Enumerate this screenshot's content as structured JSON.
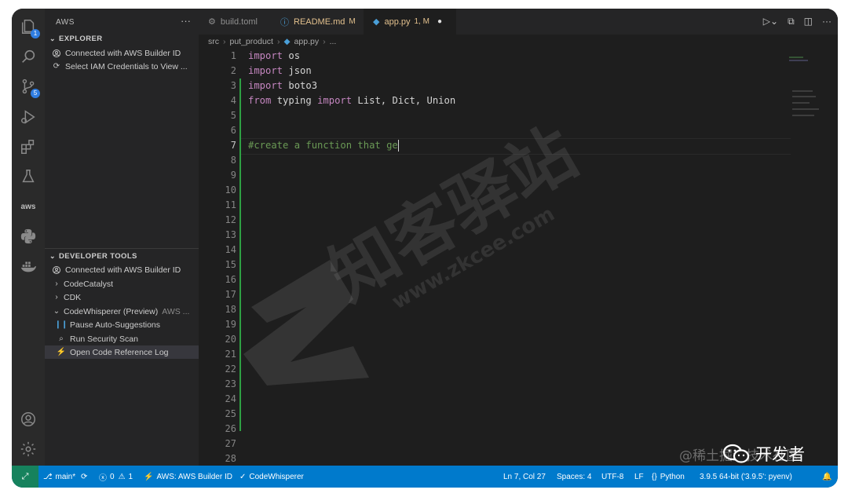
{
  "sidebar": {
    "title": "AWS",
    "more": "···",
    "explorer": {
      "header": "EXPLORER",
      "items": [
        {
          "label": "Connected with AWS Builder ID"
        },
        {
          "label": "Select IAM Credentials to View ..."
        }
      ]
    },
    "devtools": {
      "header": "DEVELOPER TOOLS",
      "items": [
        {
          "label": "Connected with AWS Builder ID"
        },
        {
          "label": "CodeCatalyst"
        },
        {
          "label": "CDK"
        },
        {
          "label": "CodeWhisperer (Preview)",
          "sub": "AWS ..."
        },
        {
          "label": "Pause Auto-Suggestions"
        },
        {
          "label": "Run Security Scan"
        },
        {
          "label": "Open Code Reference Log"
        }
      ]
    }
  },
  "activity": {
    "explorer_badge": "1",
    "scm_badge": "5",
    "aws_label": "aws"
  },
  "tabs": [
    {
      "label": "build.toml",
      "status": ""
    },
    {
      "label": "README.md",
      "status": "M"
    },
    {
      "label": "app.py",
      "status": "1, M"
    }
  ],
  "breadcrumb": [
    "src",
    "put_product",
    "app.py",
    "..."
  ],
  "editor": {
    "line_numbers": [
      "1",
      "2",
      "3",
      "4",
      "5",
      "6",
      "7",
      "8",
      "9",
      "10",
      "11",
      "12",
      "13",
      "14",
      "15",
      "16",
      "17",
      "18",
      "19",
      "20",
      "21",
      "22",
      "23",
      "24",
      "25",
      "26",
      "27",
      "28"
    ],
    "lines": [
      {
        "kw": "import",
        "rest": " os"
      },
      {
        "kw": "import",
        "rest": " json"
      },
      {
        "kw": "import",
        "rest": " boto3"
      },
      {
        "kw": "from",
        "mid": " typing ",
        "kw2": "import",
        "rest": " List, Dict, Union"
      }
    ],
    "comment": "#create a function that ge"
  },
  "status": {
    "branch": "main*",
    "problems": "0",
    "warnings": "1",
    "aws": "AWS: AWS Builder ID",
    "codewhisperer": "CodeWhisperer",
    "position": "Ln 7, Col 27",
    "spaces": "Spaces: 4",
    "encoding": "UTF-8",
    "eol": "LF",
    "language": "Python",
    "interpreter": "3.9.5 64-bit ('3.9.5': pyenv)"
  },
  "watermark": {
    "site": "www.zkcee.com",
    "corner": "@稀土掘金技术社区",
    "badge": "开发者"
  }
}
